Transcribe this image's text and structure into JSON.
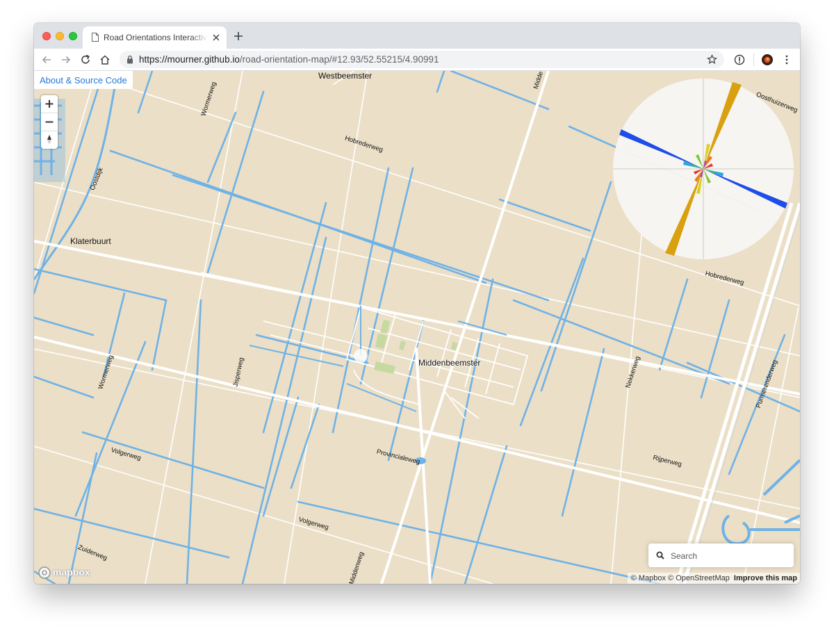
{
  "browser": {
    "tab_title": "Road Orientations Interactive Map",
    "url_host": "https://mourner.github.io",
    "url_path": "/road-orientation-map/#12.93/52.55215/4.90991"
  },
  "map": {
    "about_link": "About & Source Code",
    "zoom_in": "+",
    "zoom_out": "−",
    "search_placeholder": "Search",
    "attribution": {
      "mapbox": "© Mapbox",
      "osm": "© OpenStreetMap",
      "improve": "Improve this map"
    },
    "logo_text": "mapbox",
    "places": {
      "westbeemster": "Westbeemster",
      "klaterbuurt": "Klaterbuurt",
      "middenbeemster": "Middenbeemster"
    },
    "roads": {
      "wormerweg_top": "Wormerweg",
      "oostdijk": "Oostdijk",
      "hobrederweg_top": "Hobrederweg",
      "oosthuizerweg": "Oosthuizerweg",
      "middenweg_top": "Midde",
      "hobrederweg_right": "Hobrederweg",
      "wormerweg_left": "Wormerweg",
      "jisperweg": "Jisperweg",
      "nekkerweg": "Nekkerweg",
      "purmerenderweg": "Purmerenderweg",
      "provincialeweg": "Provincialeweg",
      "rijperweg": "Rijperweg",
      "volgerweg_left": "Volgerweg",
      "volgerweg_mid": "Volgerweg",
      "zuiderweg": "Zuiderweg",
      "middenweg_bottom": "Middenweg"
    },
    "colors": {
      "land": "#ebdfc7",
      "water": "#6fb2e6",
      "road": "#ffffff",
      "park": "#c6d9a0"
    }
  }
}
